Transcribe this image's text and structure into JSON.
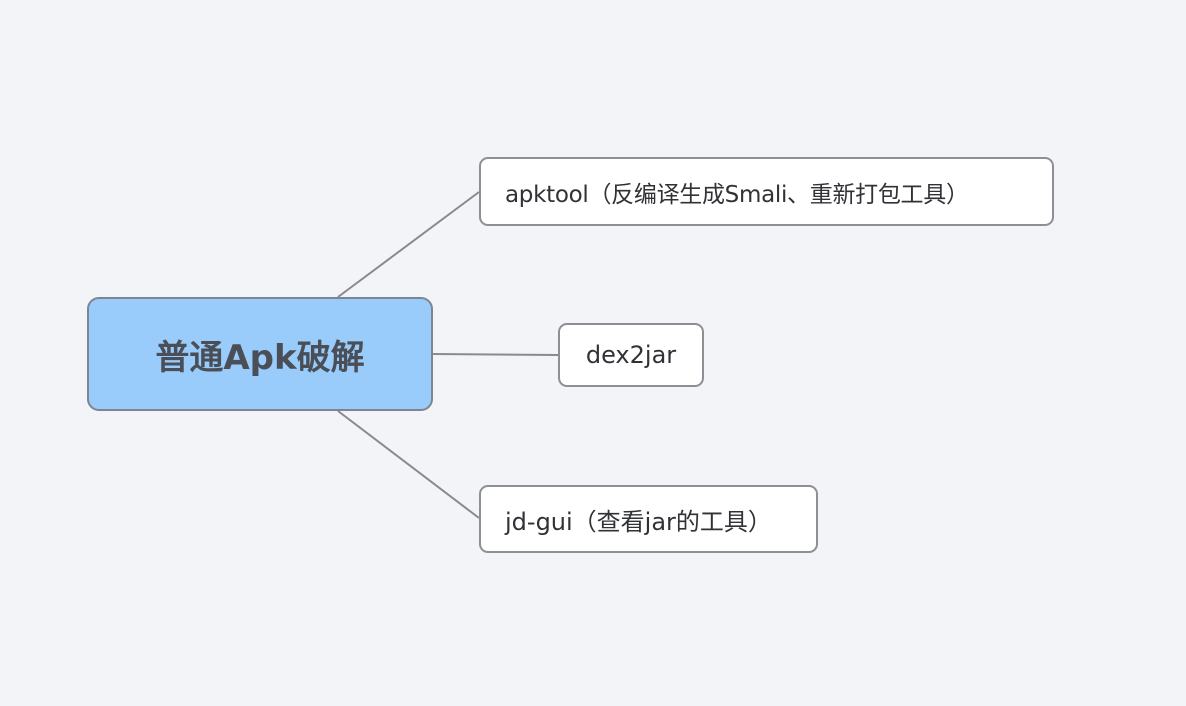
{
  "mind_map": {
    "root": {
      "label": "普通Apk破解",
      "fill_color": "#99cbfb"
    },
    "branches": [
      {
        "label": "apktool（反编译生成Smali、重新打包工具）"
      },
      {
        "label": "dex2jar"
      },
      {
        "label": "jd-gui（查看jar的工具）"
      }
    ]
  }
}
